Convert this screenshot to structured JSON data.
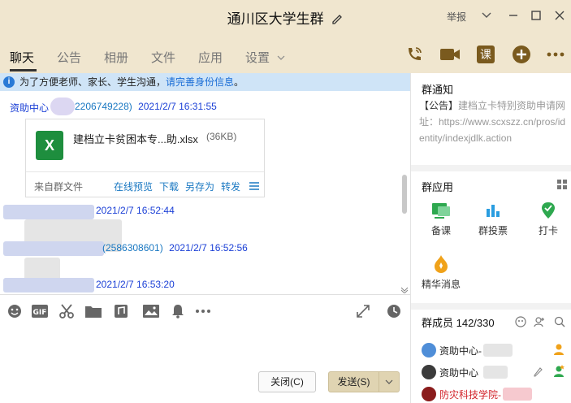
{
  "window": {
    "title": "通川区大学生群",
    "report_label": "举报"
  },
  "tabs": [
    {
      "label": "聊天"
    },
    {
      "label": "公告"
    },
    {
      "label": "相册"
    },
    {
      "label": "文件"
    },
    {
      "label": "应用"
    },
    {
      "label": "设置"
    }
  ],
  "notice": {
    "text": "为了方便老师、家长、学生沟通，",
    "link": "请完善身份信息",
    "tail": "。"
  },
  "messages": [
    {
      "sender": "资助中心",
      "qq": "2206749228)",
      "time": "2021/2/7 16:31:55"
    },
    {
      "time": "2021/2/7 16:52:44"
    },
    {
      "qq": "(2586308601)",
      "time": "2021/2/7 16:52:56"
    },
    {
      "time": "2021/2/7 16:53:20"
    }
  ],
  "file": {
    "name": "建档立卡贫困本专...助.xlsx",
    "size": "(36KB)",
    "source": "来自群文件",
    "actions": [
      "在线预览",
      "下载",
      "另存为",
      "转发"
    ]
  },
  "input": {
    "close_label": "关闭(C)",
    "send_label": "发送(S)"
  },
  "group_notice": {
    "title": "群通知",
    "tag": "【公告】",
    "content": "建档立卡特别资助申请网址：https://www.scxszz.cn/pros/identity/indexjdlk.action"
  },
  "group_apps": {
    "title": "群应用",
    "items": [
      {
        "label": "备课"
      },
      {
        "label": "群投票"
      },
      {
        "label": "打卡"
      },
      {
        "label": "精华消息"
      }
    ]
  },
  "members": {
    "title": "群成员 142/330",
    "list": [
      {
        "name": "资助中心-"
      },
      {
        "name": "资助中心"
      },
      {
        "name": "防灾科技学院-"
      }
    ]
  },
  "colors": {
    "titlebar": "#f0e6cf",
    "accent_brown": "#7a5a1e",
    "link_blue": "#1a78c2",
    "notice_bg": "#cfe4f7"
  }
}
